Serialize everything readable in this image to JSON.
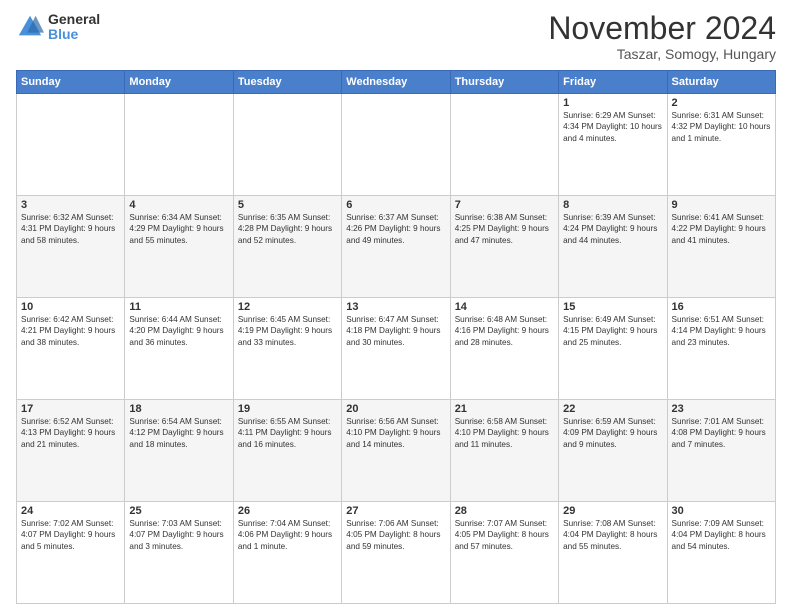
{
  "logo": {
    "general": "General",
    "blue": "Blue"
  },
  "title": "November 2024",
  "subtitle": "Taszar, Somogy, Hungary",
  "days_header": [
    "Sunday",
    "Monday",
    "Tuesday",
    "Wednesday",
    "Thursday",
    "Friday",
    "Saturday"
  ],
  "weeks": [
    [
      {
        "day": "",
        "info": ""
      },
      {
        "day": "",
        "info": ""
      },
      {
        "day": "",
        "info": ""
      },
      {
        "day": "",
        "info": ""
      },
      {
        "day": "",
        "info": ""
      },
      {
        "day": "1",
        "info": "Sunrise: 6:29 AM\nSunset: 4:34 PM\nDaylight: 10 hours\nand 4 minutes."
      },
      {
        "day": "2",
        "info": "Sunrise: 6:31 AM\nSunset: 4:32 PM\nDaylight: 10 hours\nand 1 minute."
      }
    ],
    [
      {
        "day": "3",
        "info": "Sunrise: 6:32 AM\nSunset: 4:31 PM\nDaylight: 9 hours\nand 58 minutes."
      },
      {
        "day": "4",
        "info": "Sunrise: 6:34 AM\nSunset: 4:29 PM\nDaylight: 9 hours\nand 55 minutes."
      },
      {
        "day": "5",
        "info": "Sunrise: 6:35 AM\nSunset: 4:28 PM\nDaylight: 9 hours\nand 52 minutes."
      },
      {
        "day": "6",
        "info": "Sunrise: 6:37 AM\nSunset: 4:26 PM\nDaylight: 9 hours\nand 49 minutes."
      },
      {
        "day": "7",
        "info": "Sunrise: 6:38 AM\nSunset: 4:25 PM\nDaylight: 9 hours\nand 47 minutes."
      },
      {
        "day": "8",
        "info": "Sunrise: 6:39 AM\nSunset: 4:24 PM\nDaylight: 9 hours\nand 44 minutes."
      },
      {
        "day": "9",
        "info": "Sunrise: 6:41 AM\nSunset: 4:22 PM\nDaylight: 9 hours\nand 41 minutes."
      }
    ],
    [
      {
        "day": "10",
        "info": "Sunrise: 6:42 AM\nSunset: 4:21 PM\nDaylight: 9 hours\nand 38 minutes."
      },
      {
        "day": "11",
        "info": "Sunrise: 6:44 AM\nSunset: 4:20 PM\nDaylight: 9 hours\nand 36 minutes."
      },
      {
        "day": "12",
        "info": "Sunrise: 6:45 AM\nSunset: 4:19 PM\nDaylight: 9 hours\nand 33 minutes."
      },
      {
        "day": "13",
        "info": "Sunrise: 6:47 AM\nSunset: 4:18 PM\nDaylight: 9 hours\nand 30 minutes."
      },
      {
        "day": "14",
        "info": "Sunrise: 6:48 AM\nSunset: 4:16 PM\nDaylight: 9 hours\nand 28 minutes."
      },
      {
        "day": "15",
        "info": "Sunrise: 6:49 AM\nSunset: 4:15 PM\nDaylight: 9 hours\nand 25 minutes."
      },
      {
        "day": "16",
        "info": "Sunrise: 6:51 AM\nSunset: 4:14 PM\nDaylight: 9 hours\nand 23 minutes."
      }
    ],
    [
      {
        "day": "17",
        "info": "Sunrise: 6:52 AM\nSunset: 4:13 PM\nDaylight: 9 hours\nand 21 minutes."
      },
      {
        "day": "18",
        "info": "Sunrise: 6:54 AM\nSunset: 4:12 PM\nDaylight: 9 hours\nand 18 minutes."
      },
      {
        "day": "19",
        "info": "Sunrise: 6:55 AM\nSunset: 4:11 PM\nDaylight: 9 hours\nand 16 minutes."
      },
      {
        "day": "20",
        "info": "Sunrise: 6:56 AM\nSunset: 4:10 PM\nDaylight: 9 hours\nand 14 minutes."
      },
      {
        "day": "21",
        "info": "Sunrise: 6:58 AM\nSunset: 4:10 PM\nDaylight: 9 hours\nand 11 minutes."
      },
      {
        "day": "22",
        "info": "Sunrise: 6:59 AM\nSunset: 4:09 PM\nDaylight: 9 hours\nand 9 minutes."
      },
      {
        "day": "23",
        "info": "Sunrise: 7:01 AM\nSunset: 4:08 PM\nDaylight: 9 hours\nand 7 minutes."
      }
    ],
    [
      {
        "day": "24",
        "info": "Sunrise: 7:02 AM\nSunset: 4:07 PM\nDaylight: 9 hours\nand 5 minutes."
      },
      {
        "day": "25",
        "info": "Sunrise: 7:03 AM\nSunset: 4:07 PM\nDaylight: 9 hours\nand 3 minutes."
      },
      {
        "day": "26",
        "info": "Sunrise: 7:04 AM\nSunset: 4:06 PM\nDaylight: 9 hours\nand 1 minute."
      },
      {
        "day": "27",
        "info": "Sunrise: 7:06 AM\nSunset: 4:05 PM\nDaylight: 8 hours\nand 59 minutes."
      },
      {
        "day": "28",
        "info": "Sunrise: 7:07 AM\nSunset: 4:05 PM\nDaylight: 8 hours\nand 57 minutes."
      },
      {
        "day": "29",
        "info": "Sunrise: 7:08 AM\nSunset: 4:04 PM\nDaylight: 8 hours\nand 55 minutes."
      },
      {
        "day": "30",
        "info": "Sunrise: 7:09 AM\nSunset: 4:04 PM\nDaylight: 8 hours\nand 54 minutes."
      }
    ]
  ]
}
